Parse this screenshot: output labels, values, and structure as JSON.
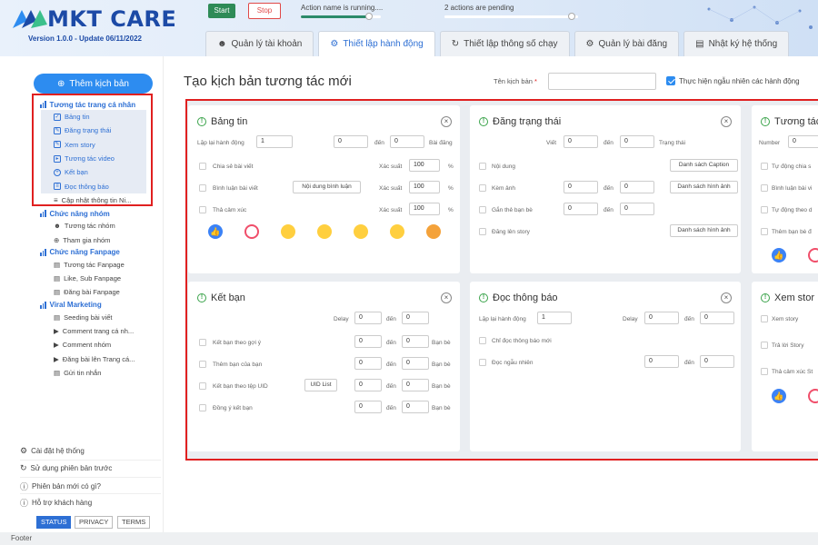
{
  "app": {
    "logo_text": "MKT CARE",
    "version": "Version 1.0.0 - Update 06/11/2022",
    "start_label": "Start",
    "stop_label": "Stop",
    "action_status": "Action name is running....",
    "pending_status": "2 actions are pending",
    "action_progress": 0.85,
    "pending_progress": 0.95
  },
  "tabs": [
    {
      "label": "Quản lý tài khoản",
      "icon": "users-icon"
    },
    {
      "label": "Thiết lập hành động",
      "icon": "gear-icon",
      "active": true
    },
    {
      "label": "Thiết lập thông số chạy",
      "icon": "refresh-icon"
    },
    {
      "label": "Quản lý bài đăng",
      "icon": "gear-icon"
    },
    {
      "label": "Nhật ký hệ thống",
      "icon": "log-icon"
    }
  ],
  "sidebar": {
    "add_button": "Thêm kịch bản",
    "groups": [
      {
        "title": "Tương tác trang cá nhân",
        "items": [
          "Bảng tin",
          "Đăng trạng thái",
          "Xem story",
          "Tương tác video",
          "Kết bạn",
          "Đọc thông báo",
          "Cập nhật thông tin Ni..."
        ]
      },
      {
        "title": "Chức năng nhóm",
        "items": [
          "Tương tác nhóm",
          "Tham gia nhóm"
        ]
      },
      {
        "title": "Chức năng Fanpage",
        "items": [
          "Tương tác Fanpage",
          "Like, Sub Fanpage",
          "Đăng bài Fanpage"
        ]
      },
      {
        "title": "Viral Marketing",
        "items": [
          "Seeding bài viết",
          "Comment trang cá nh...",
          "Comment nhóm",
          "Đăng bài lên Trang cá...",
          "Gửi tin nhắn"
        ]
      }
    ],
    "bottom": [
      "Cài đặt hệ thống",
      "Sử dụng phiên bản trước",
      "Phiên bản mới có gì?",
      "Hỗ trợ khách hàng"
    ],
    "footer_buttons": [
      "STATUS",
      "PRIVACY",
      "TERMS"
    ]
  },
  "footer": "Footer",
  "main": {
    "title": "Tạo kịch bản tương tác mới",
    "script_name_label": "Tên kịch bản",
    "required_mark": "*",
    "random_label": "Thực hiện ngẫu nhiên các hành động",
    "random_checked": true
  },
  "cards": {
    "bang_tin": {
      "title": "Bảng tin",
      "repeat_label": "Lặp lại hành động",
      "repeat_value": "1",
      "from_value": "0",
      "to_label": "đến",
      "to_value": "0",
      "unit": "Bài đăng",
      "share_label": "Chia sẻ bài viết",
      "prob_label": "Xác suất",
      "share_prob": "100",
      "pct": "%",
      "comment_label": "Bình luận bài viết",
      "comment_btn": "Nội dung bình luận",
      "comment_prob": "100",
      "react_label": "Thả cảm xúc",
      "react_prob": "100"
    },
    "dang_trang_thai": {
      "title": "Đăng trạng thái",
      "view_label": "Viết",
      "from_value": "0",
      "to_label": "đến",
      "to_value": "0",
      "unit": "Trạng thái",
      "content_label": "Nội dung",
      "caption_btn": "Danh sách Caption",
      "image_label": "Kèm ảnh",
      "img_from": "0",
      "img_to": "0",
      "image_btn": "Danh sách hình ảnh",
      "tag_label": "Gắn thẻ bạn bè",
      "tag_from": "0",
      "tag_to": "0",
      "story_label": "Đăng lên story",
      "story_btn": "Danh sách hình ảnh"
    },
    "tuong_tac": {
      "title": "Tương tác",
      "number_label": "Number",
      "number_value": "0",
      "items": [
        "Tự động chia s",
        "Bình luận bài vi",
        "Tự động theo d",
        "Thêm bạn bè đ"
      ]
    },
    "ket_ban": {
      "title": "Kết bạn",
      "delay_label": "Delay",
      "delay_value": "0",
      "to_label": "đến",
      "to_value": "0",
      "rows": [
        {
          "label": "Kết bạn theo gợi ý",
          "from": "0",
          "to": "0",
          "unit": "Bạn bè"
        },
        {
          "label": "Thêm bạn của bạn",
          "from": "0",
          "to": "0",
          "unit": "Bạn bè"
        },
        {
          "label": "Kết bạn theo tệp UID",
          "btn": "UID List",
          "from": "0",
          "to": "0",
          "unit": "Bạn bè"
        },
        {
          "label": "Đồng ý kết bạn",
          "from": "0",
          "to": "0",
          "unit": "Bạn bè"
        }
      ]
    },
    "doc_thong_bao": {
      "title": "Đọc thông báo",
      "repeat_label": "Lặp lại hành động",
      "repeat_value": "1",
      "delay_label": "Delay",
      "delay_value": "0",
      "to_label": "đến",
      "to_value": "0",
      "only_new_label": "Chỉ đọc thông báo mới",
      "random_label": "Đọc ngẫu nhiên",
      "rand_from": "0",
      "rand_to": "0"
    },
    "xem_story": {
      "title": "Xem stor",
      "items": [
        "Xem story",
        "Trả lời Story",
        "Thả cảm xúc St"
      ]
    }
  }
}
